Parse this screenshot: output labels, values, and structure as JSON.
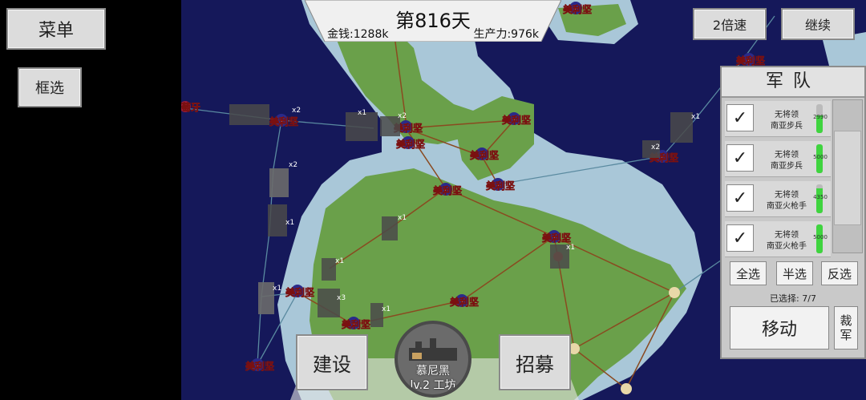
{
  "top": {
    "day": "第816天",
    "money": "金钱:1288k",
    "production": "生产力:976k"
  },
  "left": {
    "menu_label": "菜单",
    "box_select_label": "框选"
  },
  "controls": {
    "speed_label": "2倍速",
    "continue_label": "继续"
  },
  "bottom": {
    "build_label": "建设",
    "recruit_label": "招募",
    "city_name": "慕尼黑",
    "city_info": "lv.2 工坊"
  },
  "army_panel": {
    "title": "军队",
    "units": [
      {
        "leader": "无将领",
        "type": "南亚步兵",
        "count": "2990",
        "fill": 0.6
      },
      {
        "leader": "无将领",
        "type": "南亚步兵",
        "count": "5000",
        "fill": 1.0
      },
      {
        "leader": "无将领",
        "type": "南亚火枪手",
        "count": "4350",
        "fill": 0.87
      },
      {
        "leader": "无将领",
        "type": "南亚火枪手",
        "count": "5000",
        "fill": 1.0
      }
    ],
    "select_all": "全选",
    "select_half": "半选",
    "invert": "反选",
    "selected_text": "已选择: 7/7",
    "move_label": "移动",
    "disband_label": "裁军",
    "check_mark": "✓"
  },
  "map": {
    "cities": [
      {
        "name": "葡萄牙",
        "color": "#9a1a3a"
      },
      {
        "name": "美利坚",
        "color": "#2a2a8a"
      }
    ],
    "unit_counts": [
      "x2",
      "x1",
      "x2",
      "x2",
      "x1",
      "x1",
      "x1",
      "x3",
      "x1",
      "x1",
      "x2",
      "x1",
      "x1"
    ]
  },
  "colors": {
    "ocean": "#15185a",
    "shallow": "#a9c7d8",
    "land": "#6aa04a",
    "road": "#8a4a20",
    "route": "#5a8aa0"
  }
}
